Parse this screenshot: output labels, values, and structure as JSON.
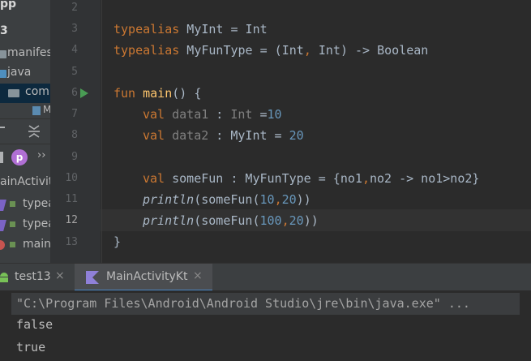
{
  "sidebar": {
    "top_title": "pp",
    "module": "3",
    "items": [
      "manifes",
      "java",
      "com."
    ],
    "partial_label": "M",
    "toolbar_expand": "›› ",
    "structure_class": "ainActivit",
    "members": [
      "typea",
      "typea",
      "main"
    ],
    "p_badge": "p"
  },
  "editor": {
    "lines": [
      {
        "num": "2"
      },
      {
        "num": "3"
      },
      {
        "num": "4"
      },
      {
        "num": "5"
      },
      {
        "num": "6"
      },
      {
        "num": "7"
      },
      {
        "num": "8"
      },
      {
        "num": "9"
      },
      {
        "num": "10"
      },
      {
        "num": "11"
      },
      {
        "num": "12"
      },
      {
        "num": "13"
      }
    ],
    "code": {
      "l3_kw": "typealias",
      "l3_rest": " MyInt = Int",
      "l4_kw": "typealias",
      "l4_rest1": " MyFunType = (Int",
      "l4_comma": ",",
      "l4_rest2": " Int) -> Boolean",
      "l6_kw": "fun",
      "l6_name": "main",
      "l6_rest": "() {",
      "l7_kw": "val",
      "l7_var": "data1",
      "l7_colon": " : ",
      "l7_type": "Int",
      "l7_eq": " =",
      "l7_num": "10",
      "l8_kw": "val",
      "l8_var": "data2",
      "l8_rest": " : MyInt = ",
      "l8_num": "20",
      "l10_kw": "val",
      "l10_rest1": " someFun : MyFunType = {no1",
      "l10_c1": ",",
      "l10_rest2": "no2 -> no1>no2}",
      "l11_fn": "println",
      "l11_rest1": "(someFun(",
      "l11_n1": "10",
      "l11_c": ",",
      "l11_n2": "20",
      "l11_rest2": "))",
      "l12_fn": "println",
      "l12_rest1": "(someFun(",
      "l12_n1": "100",
      "l12_c": ",",
      "l12_n2": "20",
      "l12_rest2": "))",
      "l13": "}"
    }
  },
  "run_tabs": [
    {
      "label": "test13",
      "close": "×"
    },
    {
      "label": "MainActivityKt",
      "close": "×"
    }
  ],
  "console": {
    "command": "\"C:\\Program Files\\Android\\Android Studio\\jre\\bin\\java.exe\" ...",
    "out1": "false",
    "out2": "true"
  },
  "colors": {
    "editor_bg": "#2b2b2b",
    "keyword": "#cc7832",
    "function": "#ffc66d",
    "number": "#6897bb",
    "text": "#a9b7c6",
    "run_green": "#499c54"
  }
}
